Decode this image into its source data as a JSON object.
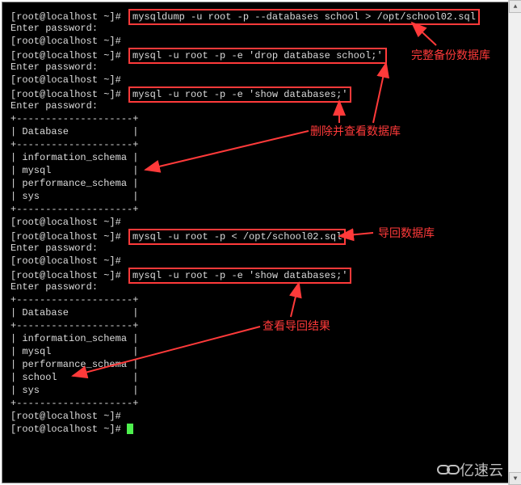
{
  "prompt": "[root@localhost ~]#",
  "enter_password": "Enter password:",
  "commands": {
    "cmd1": "mysqldump -u root -p --databases school > /opt/school02.sql",
    "cmd2": "mysql -u root -p -e 'drop database school;'",
    "cmd3": "mysql -u root -p -e 'show databases;'",
    "cmd4": "mysql -u root -p < /opt/school02.sql",
    "cmd5": "mysql -u root -p -e 'show databases;'"
  },
  "table_border": "+--------------------+",
  "table_header": "| Database           |",
  "db_list1": {
    "r1": "| information_schema |",
    "r2": "| mysql              |",
    "r3": "| performance_schema |",
    "r4": "| sys                |"
  },
  "db_list2": {
    "r1": "| information_schema |",
    "r2": "| mysql              |",
    "r3": "| performance_schema |",
    "r4": "| school             |",
    "r5": "| sys                |"
  },
  "annotations": {
    "a1": "完整备份数据库",
    "a2": "删除并查看数据库",
    "a3": "导回数据库",
    "a4": "查看导回结果"
  },
  "watermark": "亿速云"
}
